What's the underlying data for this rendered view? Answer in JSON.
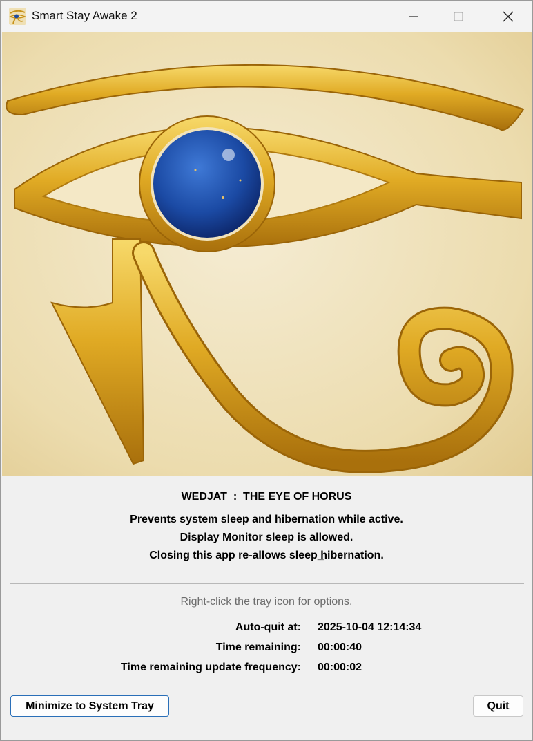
{
  "window": {
    "title": "Smart Stay Awake 2",
    "app_icon": "eye-of-horus-icon",
    "controls": [
      "minimize-icon",
      "maximize-icon",
      "close-icon"
    ]
  },
  "hero": {
    "image": "eye-of-horus-illustration"
  },
  "main": {
    "heading": "WEDJAT  :  THE EYE OF HORUS",
    "description_lines": [
      "Prevents system sleep and hibernation while active.",
      "Display Monitor sleep is allowed.",
      "Closing this app re-allows sleep ̲hibernation."
    ],
    "hint": "Right-click the tray icon for options.",
    "info": [
      {
        "label": "Auto-quit at:",
        "value": "2025-10-04 12:14:34"
      },
      {
        "label": "Time remaining:",
        "value": "00:00:40"
      },
      {
        "label": "Time remaining update frequency:",
        "value": "00:00:02"
      }
    ]
  },
  "buttons": {
    "minimize_to_tray": "Minimize to System Tray",
    "quit": "Quit"
  },
  "colors": {
    "gold": "#d9a621",
    "lapis": "#1e4aa0",
    "background": "#f0f0f0",
    "primary_border": "#2a6fb8"
  }
}
